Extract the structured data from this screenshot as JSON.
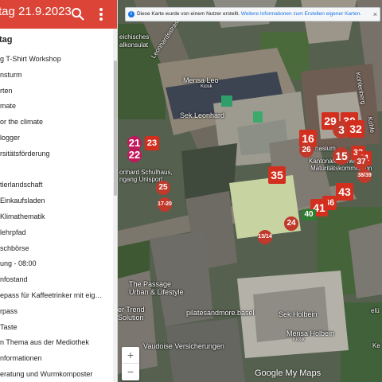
{
  "header": {
    "title": "tag 21.9.2023",
    "color": "#db4437",
    "search_icon": "search-icon",
    "more_icon": "more-vert-icon"
  },
  "layer": {
    "title": "tag"
  },
  "items": [
    "g T-Shirt Workshop",
    "nsturm",
    "rten",
    "mate",
    "or the climate",
    "logger",
    "rsitätsförderung",
    "",
    "tierlandschaft",
    " Einkaufsladen",
    " Klimathematik",
    "lehrpfad",
    "schbörse",
    "ung - 08:00",
    "nfostand",
    "epass für Kaffeetrinker mit eig…",
    "rpass",
    "Taste",
    "n Thema aus der Mediothek",
    "nformationen",
    "eratung und Wurmkomposter"
  ],
  "notice": {
    "text": "Diese Karte wurde von einem Nutzer erstellt.",
    "link": "Weitere Informationen zum Erstellen eigener Karten.",
    "close": "×"
  },
  "map_labels": {
    "konsulat_1": "eichisches",
    "konsulat_2": "alkonsulat",
    "leonhardsstrasse": "Leonhardsstrasse",
    "kohlenberg": "Kohlenberg",
    "kohlenberg2": "Kohle",
    "mensa_leo": "Mensa Leo",
    "mensa_leo_kiosk": "Kiosk",
    "sek_leonhard": "Sek Leonhard",
    "schulhaus_1": "onhard Schulhaus,",
    "schulhaus_2": "ngang Unisport",
    "gymnasium": "nasium",
    "kantonale_1": "Kantonale Verwaltung",
    "kantonale_2": "Maturitätskommission",
    "passage_1": "The Passage",
    "passage_2": "Urban & Lifestyle",
    "trend_1": "er Trend",
    "trend_2": "Solution",
    "pilates": "pilatesandmore.basel",
    "sek_holbein": "Sek Holbein",
    "mensa_holbein": "Mensa Holbein",
    "mensa_holbein_kiosk": "Kiosk",
    "vaudoise": "Vaudoise Versicherungen",
    "elu_1": "elü",
    "elu_2": "Ke"
  },
  "markers": [
    {
      "label": "21",
      "style": "pink"
    },
    {
      "label": "22",
      "style": "pink"
    },
    {
      "label": "23",
      "style": "sq"
    },
    {
      "label": "25",
      "style": "circ"
    },
    {
      "label": "17-20",
      "style": "circ small"
    },
    {
      "label": "35",
      "style": "sq big"
    },
    {
      "label": "16",
      "style": "sq big"
    },
    {
      "label": "26",
      "style": "circ"
    },
    {
      "label": "29",
      "style": "sq big"
    },
    {
      "label": "30",
      "style": "sq big"
    },
    {
      "label": "3",
      "style": "circ big"
    },
    {
      "label": "32",
      "style": "sq big"
    },
    {
      "label": "15",
      "style": "circ big"
    },
    {
      "label": "33",
      "style": "sq"
    },
    {
      "label": "31",
      "style": "sq"
    },
    {
      "label": "37",
      "style": "circ"
    },
    {
      "label": "38/39",
      "style": "circ small"
    },
    {
      "label": "43",
      "style": "sq big"
    },
    {
      "label": "36",
      "style": "sq"
    },
    {
      "label": "41",
      "style": "sq big"
    },
    {
      "label": "40",
      "style": "green"
    },
    {
      "label": "24",
      "style": "circ"
    },
    {
      "label": "13/14",
      "style": "circ small"
    }
  ],
  "zoom": {
    "in": "+",
    "out": "−"
  },
  "attribution": "Google My Maps"
}
